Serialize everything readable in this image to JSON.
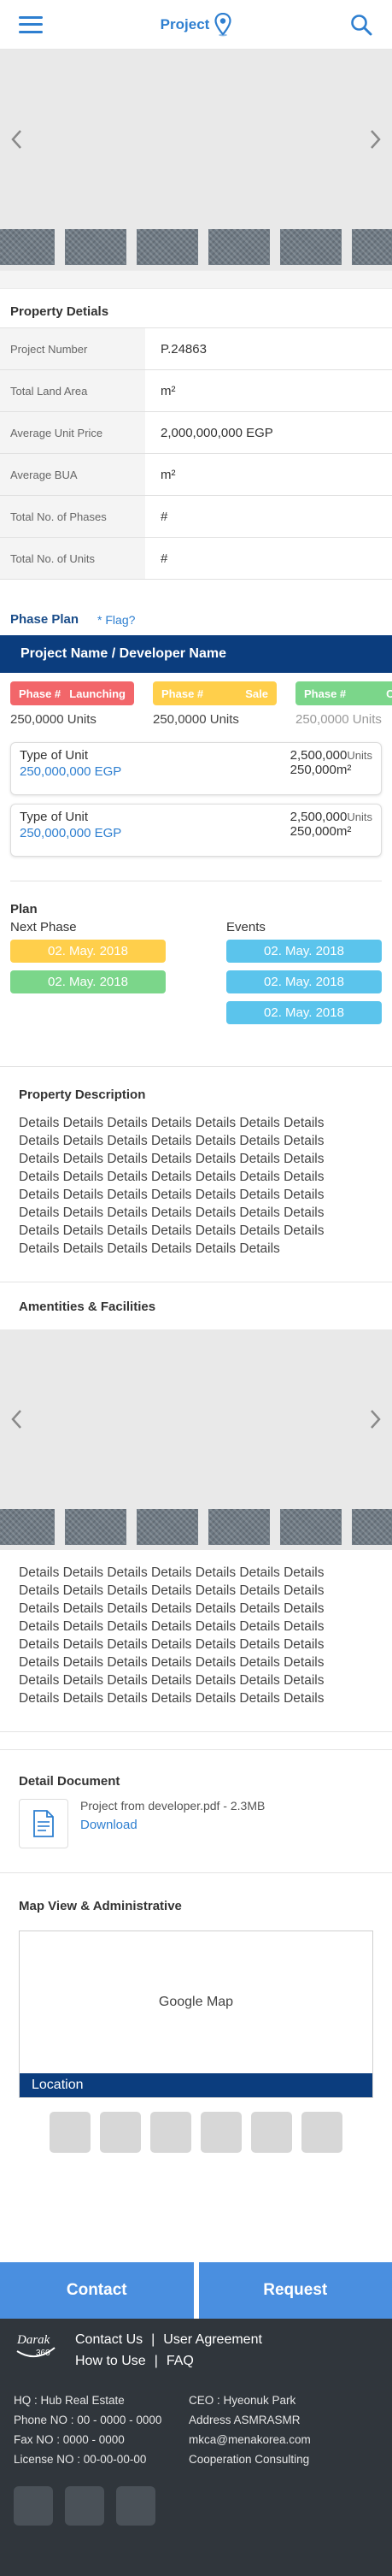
{
  "header": {
    "brand": "Project",
    "brand_color": "#2e7fd0"
  },
  "details": {
    "title": "Property Detials",
    "rows": [
      {
        "label": "Project Number",
        "value": "P.24863"
      },
      {
        "label": "Total Land Area",
        "value": "m²"
      },
      {
        "label": "Average Unit Price",
        "value": "2,000,000,000 EGP"
      },
      {
        "label": "Average BUA",
        "value": "m²"
      },
      {
        "label": "Total No. of Phases",
        "value": "#"
      },
      {
        "label": "Total No. of Units",
        "value": "#"
      }
    ]
  },
  "phase_plan": {
    "title": "Phase Plan",
    "flag": "* Flag?",
    "project_name": "Project Name / Developer Name",
    "phases": [
      {
        "name": "Phase #",
        "status": "Launching",
        "color": "#f2666a",
        "units": "250,0000 Units"
      },
      {
        "name": "Phase #",
        "status": "Sale",
        "color": "#ffcf4b",
        "units": "250,0000 Units"
      },
      {
        "name": "Phase #",
        "status": "Com",
        "color": "#7bd68a",
        "units": "250,0000 Units"
      }
    ],
    "units": [
      {
        "type": "Type of Unit",
        "price": "250,000,000 EGP",
        "count": "2,500,000",
        "count_unit": "Units",
        "area": "250,000m²"
      },
      {
        "type": "Type of Unit",
        "price": "250,000,000 EGP",
        "count": "2,500,000",
        "count_unit": "Units",
        "area": "250,000m²"
      }
    ]
  },
  "plan": {
    "title": "Plan",
    "next_phase_label": "Next Phase",
    "events_label": "Events",
    "next_phase": [
      {
        "date": "02. May. 2018",
        "color": "#ffcf4b"
      },
      {
        "date": "02. May. 2018",
        "color": "#7bd68a"
      }
    ],
    "events": [
      {
        "date": "02. May. 2018",
        "color": "#5bc4ec"
      },
      {
        "date": "02. May. 2018",
        "color": "#5bc4ec"
      },
      {
        "date": "02. May. 2018",
        "color": "#5bc4ec"
      }
    ]
  },
  "description": {
    "title": "Property Description",
    "lines": [
      "Details Details Details Details Details Details Details",
      "Details Details Details Details Details Details Details",
      "Details Details Details Details Details Details Details",
      "Details Details Details Details Details Details Details",
      "Details Details Details Details Details Details Details",
      "Details Details Details Details Details Details Details",
      "Details Details Details Details Details Details Details",
      "Details Details Details Details Details Details"
    ]
  },
  "amenities": {
    "title": "Amentities & Facilities",
    "lines": [
      "Details Details Details Details Details Details Details",
      "Details Details Details Details Details Details Details",
      "Details Details Details Details Details Details Details",
      "Details Details Details Details Details Details Details",
      "Details Details Details Details Details Details Details",
      "Details Details Details Details Details Details Details",
      "Details Details Details Details Details Details Details",
      "Details Details Details Details Details Details Details"
    ]
  },
  "document": {
    "title": "Detail Document",
    "file": "Project from developer.pdf - 2.3MB",
    "download": "Download"
  },
  "map": {
    "title": "Map View & Administrative",
    "placeholder": "Google Map",
    "location": "Location"
  },
  "cta": {
    "contact": "Contact",
    "request": "Request"
  },
  "footer": {
    "logo_text": "Darak",
    "logo_sub": "360",
    "links_row1": [
      "Contact Us",
      "User Agreement"
    ],
    "links_row2": [
      "How to Use",
      "FAQ"
    ],
    "info": [
      [
        "HQ : Hub Real Estate",
        "CEO : Hyeonuk Park"
      ],
      [
        "Phone NO : 00 - 0000 - 0000",
        "Address ASMRASMR"
      ],
      [
        "Fax NO : 0000 - 0000",
        "mkca@menakorea.com"
      ],
      [
        "License NO : 00-00-00-00",
        "Cooperation Consulting"
      ]
    ]
  }
}
